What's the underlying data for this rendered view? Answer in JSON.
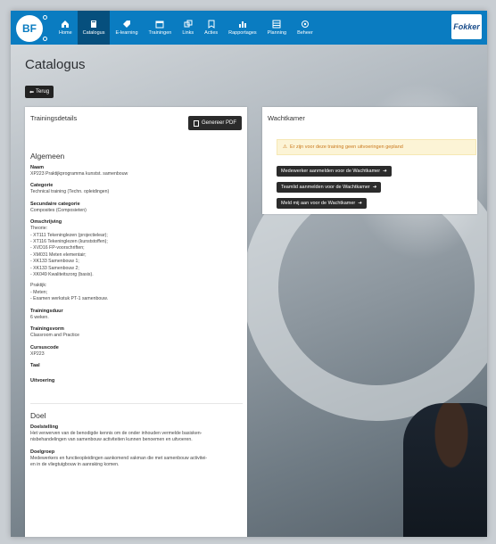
{
  "brand": {
    "initials": "BF",
    "logo_text": "Fokker"
  },
  "nav": [
    {
      "label": "Home",
      "icon": "home-icon"
    },
    {
      "label": "Catalogus",
      "icon": "book-icon",
      "active": true
    },
    {
      "label": "E-learning",
      "icon": "tag-icon"
    },
    {
      "label": "Trainingen",
      "icon": "calendar-icon"
    },
    {
      "label": "Links",
      "icon": "link-icon"
    },
    {
      "label": "Acties",
      "icon": "bookmark-icon"
    },
    {
      "label": "Rapportages",
      "icon": "chart-icon"
    },
    {
      "label": "Planning",
      "icon": "grid-icon"
    },
    {
      "label": "Beheer",
      "icon": "settings-icon"
    }
  ],
  "page": {
    "title": "Catalogus",
    "back_label": "Terug"
  },
  "details": {
    "title": "Trainingsdetails",
    "pdf_label": "Genereer PDF",
    "general_heading": "Algemeen",
    "fields": {
      "naam_label": "Naam",
      "naam_value": "XP223 Praktijkprogramma kunstst. samenbouw",
      "categorie_label": "Categorie",
      "categorie_value": "Technical training (Techn. opleidingen)",
      "secundaire_label": "Secundaire categorie",
      "secundaire_value": "Composites (Composieten)",
      "omschrijving_label": "Omschrijving",
      "omschrijving_lines": [
        "Theorie:",
        "- XT111 Tekeninglezen (projectielear);",
        "- XT116 Tekeninglezen (kunststoffen);",
        "- XVD16 FP-voorschriften;",
        "- XM031 Meten elementair;",
        "- XK133 Samenbouw 1;",
        "- XK133 Samenbouw 2;",
        "- XK049 Kwaliteitszorg (basis)."
      ],
      "praktijk_lines": [
        "Praktijk:",
        "- Meten;",
        "- Examen werkstuk PT-1 samenbouw."
      ],
      "trainingsduur_label": "Trainingsduur",
      "trainingsduur_value": "6 weken.",
      "trainingsvorm_label": "Trainingsvorm",
      "trainingsvorm_value": "Classroom and Practice",
      "cursuscode_label": "Cursuscode",
      "cursuscode_value": "XP223",
      "taal_label": "Taal",
      "uitvoering_label": "Uitvoering"
    },
    "doel_heading": "Doel",
    "doelstelling_label": "Doelstelling",
    "doelstelling_lines": [
      "Het verwerven van de benodigde kennis om de onder inhouden vermelde basisken-",
      "nisbehandelingen van samenbouw activiteiten kunnen benoemen en uitvoeren."
    ],
    "doelgroep_label": "Doelgroep",
    "doelgroep_lines": [
      "Medewerkers en functieopleidingen aankomend vakman die met samenbouw activitei-",
      "en in de vliegtuigbouw in aanraking komen."
    ]
  },
  "wachtkamer": {
    "title": "Wachtkamer",
    "alert": "Er zijn voor deze training geen uitvoeringen gepland",
    "btn_medewerker": "Medewerker aanmelden voor de Wachtkamer",
    "btn_teamlid": "Teamlid aanmelden voor de Wachtkamer",
    "btn_mij": "Meld mij aan voor de Wachtkamer"
  },
  "colors": {
    "navbar": "#0a7cc1",
    "navbar_active": "#064f7d",
    "alert_bg": "#fcf4d6",
    "alert_text": "#c9781c"
  }
}
